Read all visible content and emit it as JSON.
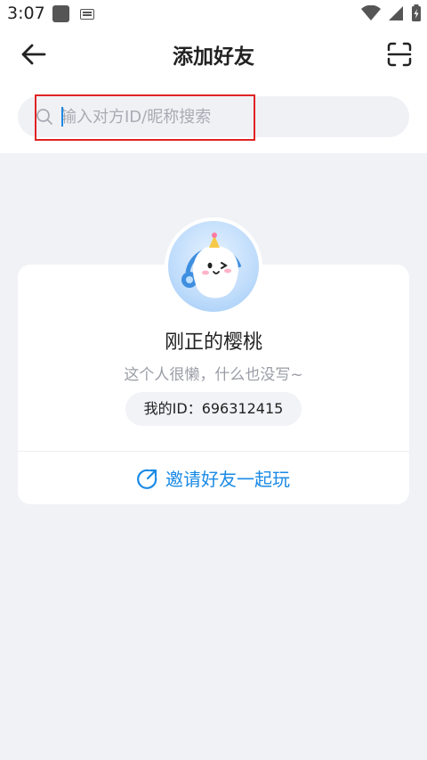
{
  "status_bar": {
    "time": "3:07"
  },
  "header": {
    "title": "添加好友"
  },
  "search": {
    "placeholder": "输入对方ID/昵称搜索",
    "value": ""
  },
  "profile": {
    "nickname": "刚正的樱桃",
    "bio": "这个人很懒，什么也没写~",
    "id_text": "我的ID：696312415"
  },
  "invite": {
    "label": "邀请好友一起玩"
  },
  "colors": {
    "accent": "#1a8ae6",
    "highlight": "#e02424"
  }
}
